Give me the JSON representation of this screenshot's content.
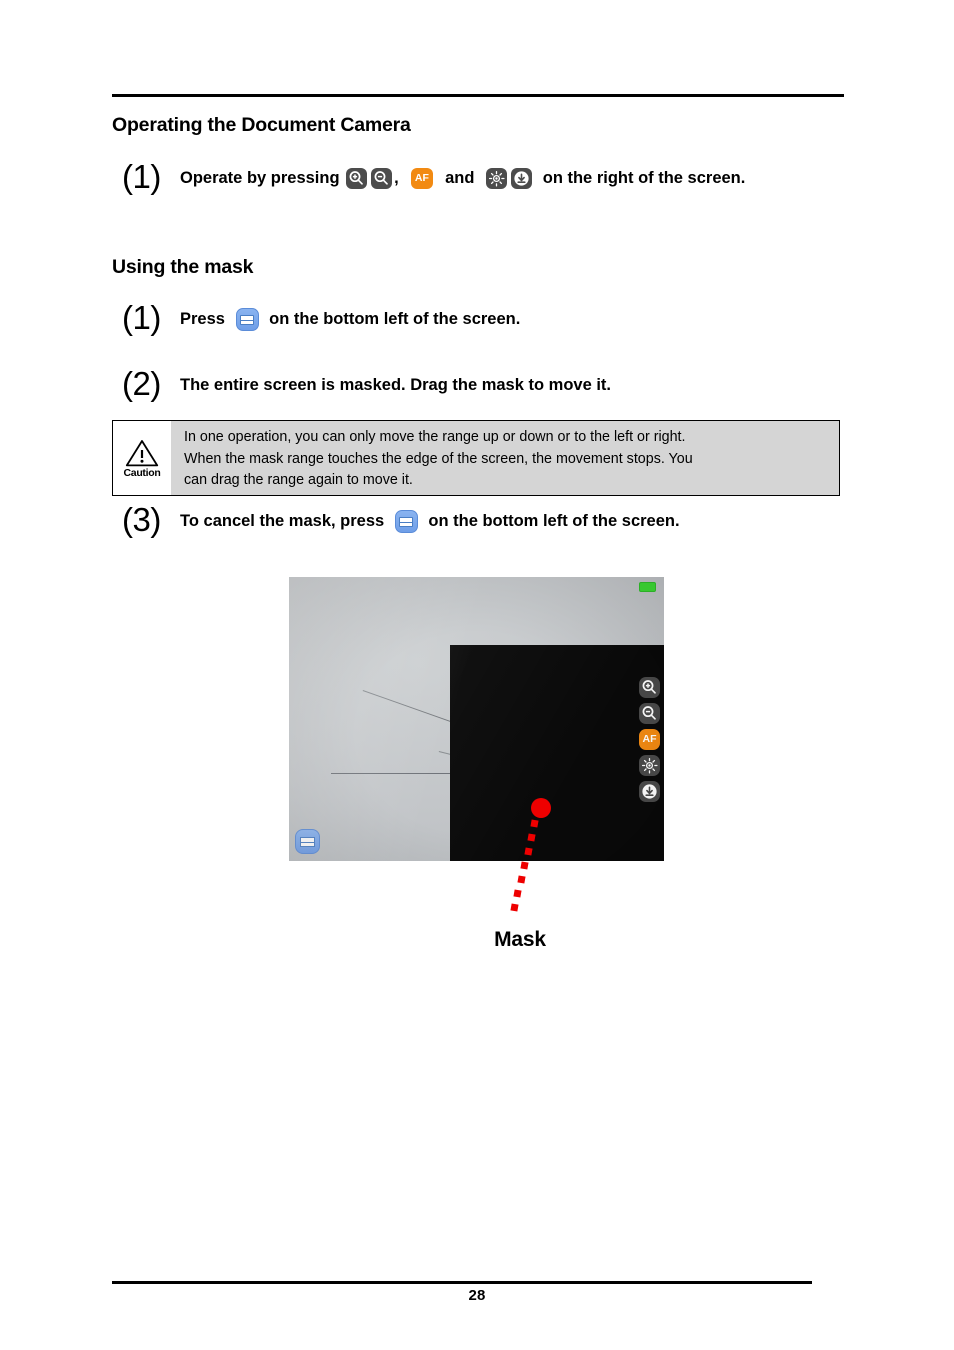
{
  "document": {
    "page_number": "28"
  },
  "sections": [
    {
      "heading": "Operating the Document Camera",
      "steps": [
        {
          "number": "(1)",
          "parts": [
            {
              "type": "text",
              "value": "Operate by pressing "
            },
            {
              "type": "icon",
              "name": "zoom-in-icon"
            },
            {
              "type": "icon",
              "name": "zoom-out-icon"
            },
            {
              "type": "text",
              "value": ",  "
            },
            {
              "type": "icon",
              "name": "af-icon",
              "label": "AF"
            },
            {
              "type": "text",
              "value": "  and  "
            },
            {
              "type": "icon",
              "name": "brightness-icon"
            },
            {
              "type": "icon",
              "name": "download-icon"
            },
            {
              "type": "text",
              "value": "  on the right of the screen."
            }
          ]
        }
      ]
    },
    {
      "heading": "Using the mask",
      "steps": [
        {
          "number": "(1)",
          "parts": [
            {
              "type": "text",
              "value": "Press "
            },
            {
              "type": "icon",
              "name": "mask-toggle-icon"
            },
            {
              "type": "text",
              "value": " on the bottom left of the screen."
            }
          ]
        },
        {
          "number": "(2)",
          "parts": [
            {
              "type": "text",
              "value": "The entire screen is masked. Drag the mask to move it."
            }
          ]
        },
        {
          "number": "(3)",
          "parts": [
            {
              "type": "text",
              "value": "To cancel the mask, press "
            },
            {
              "type": "icon",
              "name": "mask-toggle-icon"
            },
            {
              "type": "text",
              "value": " on the bottom left of the screen."
            }
          ]
        }
      ]
    }
  ],
  "caution": {
    "icon_label": "Caution",
    "lines": [
      "In one operation, you can only move the range up or down or to the left or right.",
      "When the mask range touches the edge of the screen, the movement stops. You",
      "can drag the range again to move it."
    ]
  },
  "figure": {
    "callout_label": "Mask",
    "callout_color": "#ee0000",
    "screen": {
      "status_badge": {
        "name": "battery-indicator",
        "color": "#3ddb35"
      },
      "mask_color": "#090909",
      "toolbar": [
        {
          "name": "zoom-in-icon",
          "label": ""
        },
        {
          "name": "zoom-out-icon",
          "label": ""
        },
        {
          "name": "af-icon",
          "label": "AF"
        },
        {
          "name": "brightness-icon",
          "label": ""
        },
        {
          "name": "download-icon",
          "label": ""
        }
      ],
      "mask_button": {
        "name": "mask-toggle-icon",
        "color": "#7aa8ec"
      }
    }
  }
}
